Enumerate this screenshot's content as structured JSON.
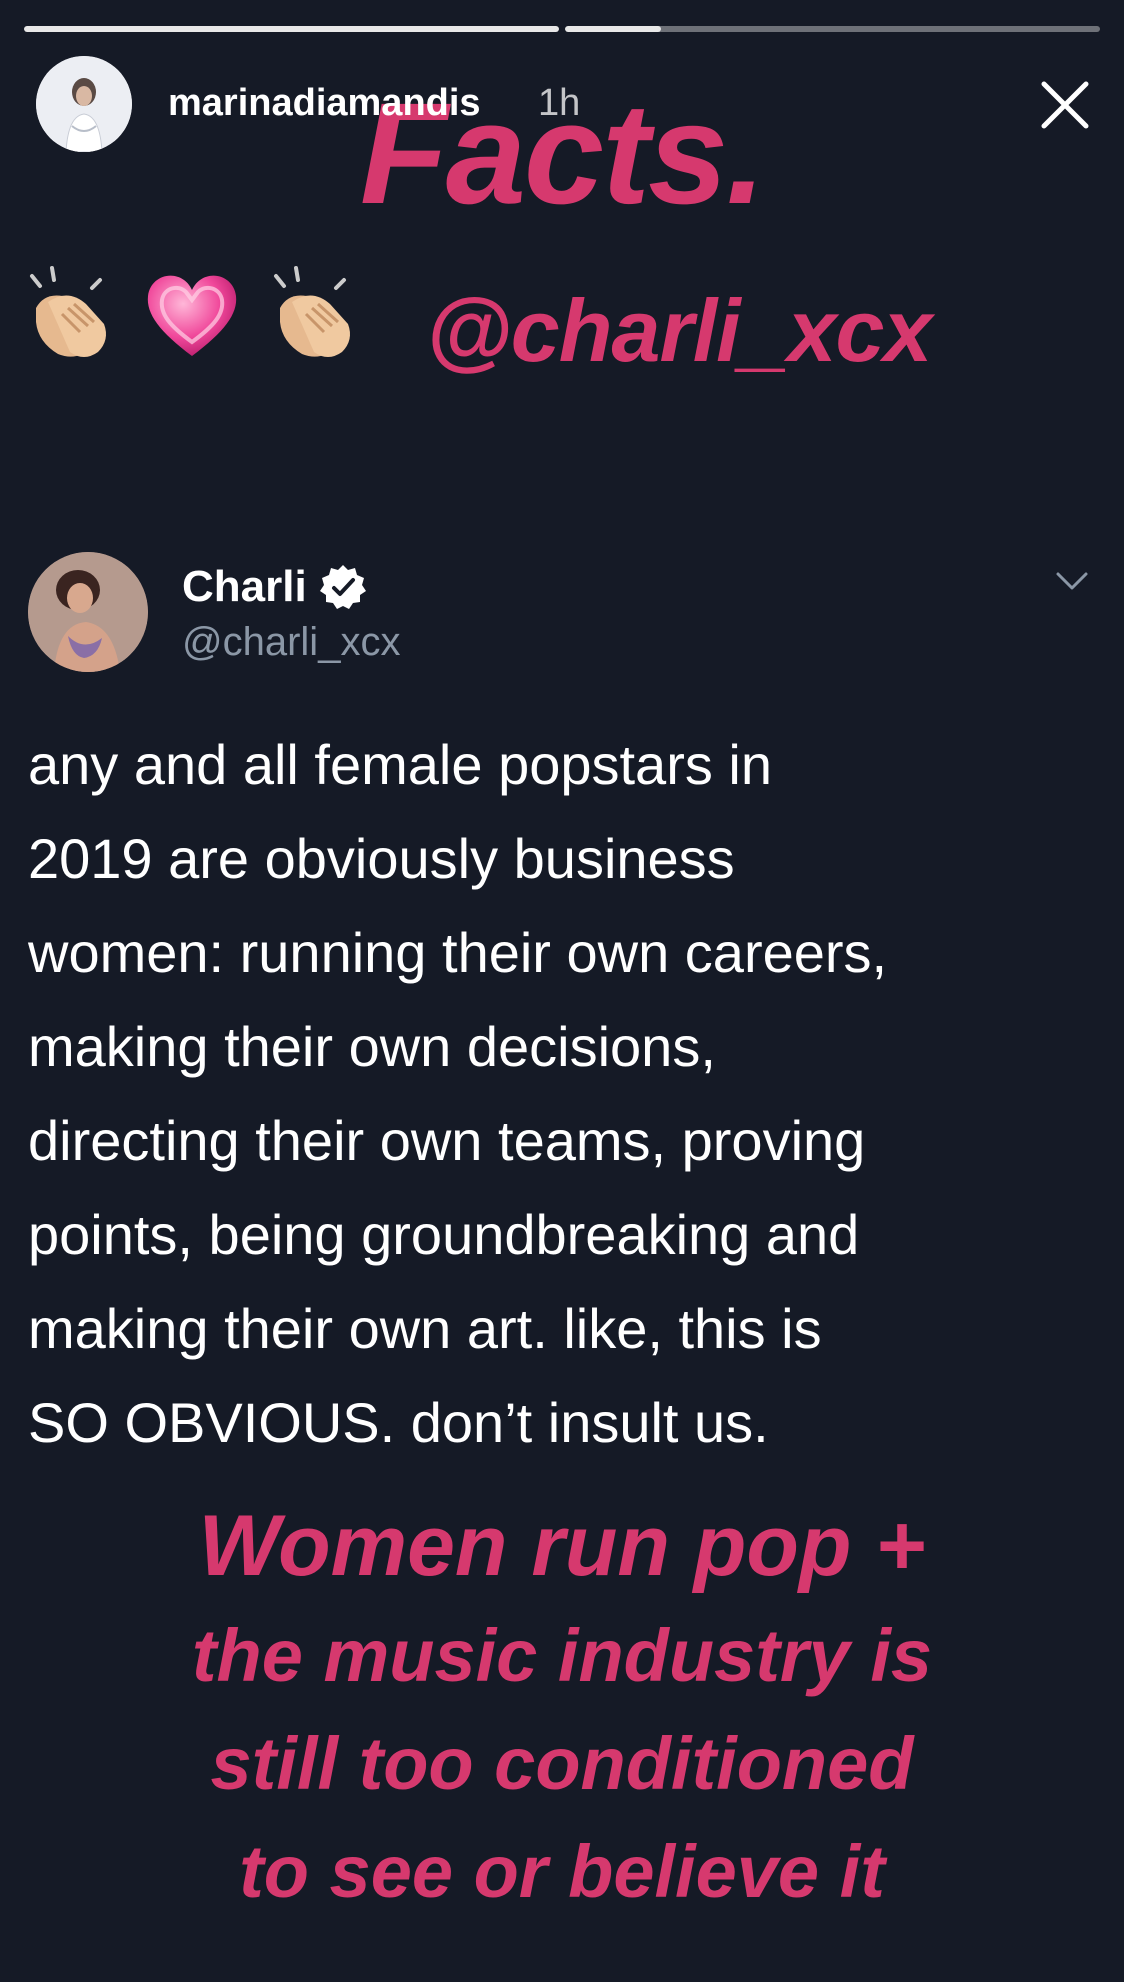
{
  "story": {
    "progress": [
      {
        "fraction": 1.0
      },
      {
        "fraction": 0.18
      }
    ],
    "username": "marinadiamandis",
    "timestamp": "1h",
    "close_icon": "close-icon"
  },
  "sticker": {
    "headline": "Facts.",
    "emojis": [
      "clapping-hands-icon",
      "pink-heart-icon",
      "clapping-hands-icon"
    ],
    "mention": "@charli_xcx"
  },
  "tweet": {
    "name": "Charli",
    "handle": "@charli_xcx",
    "verified_icon": "verified-badge-icon",
    "menu_icon": "chevron-down-icon",
    "text": "any and all female popstars in\n2019 are obviously business\nwomen: running their own careers,\nmaking their own decisions,\ndirecting their own teams, proving\npoints, being groundbreaking and\nmaking their own art. like, this is\nSO OBVIOUS. don’t insult us."
  },
  "caption": {
    "line1": "Women run pop +",
    "line2": "the music industry is",
    "line3": "still too conditioned",
    "line4": "to see or believe it"
  },
  "colors": {
    "background": "#151a26",
    "accent_pink": "#d6396e",
    "handle_gray": "#8b97a6"
  }
}
